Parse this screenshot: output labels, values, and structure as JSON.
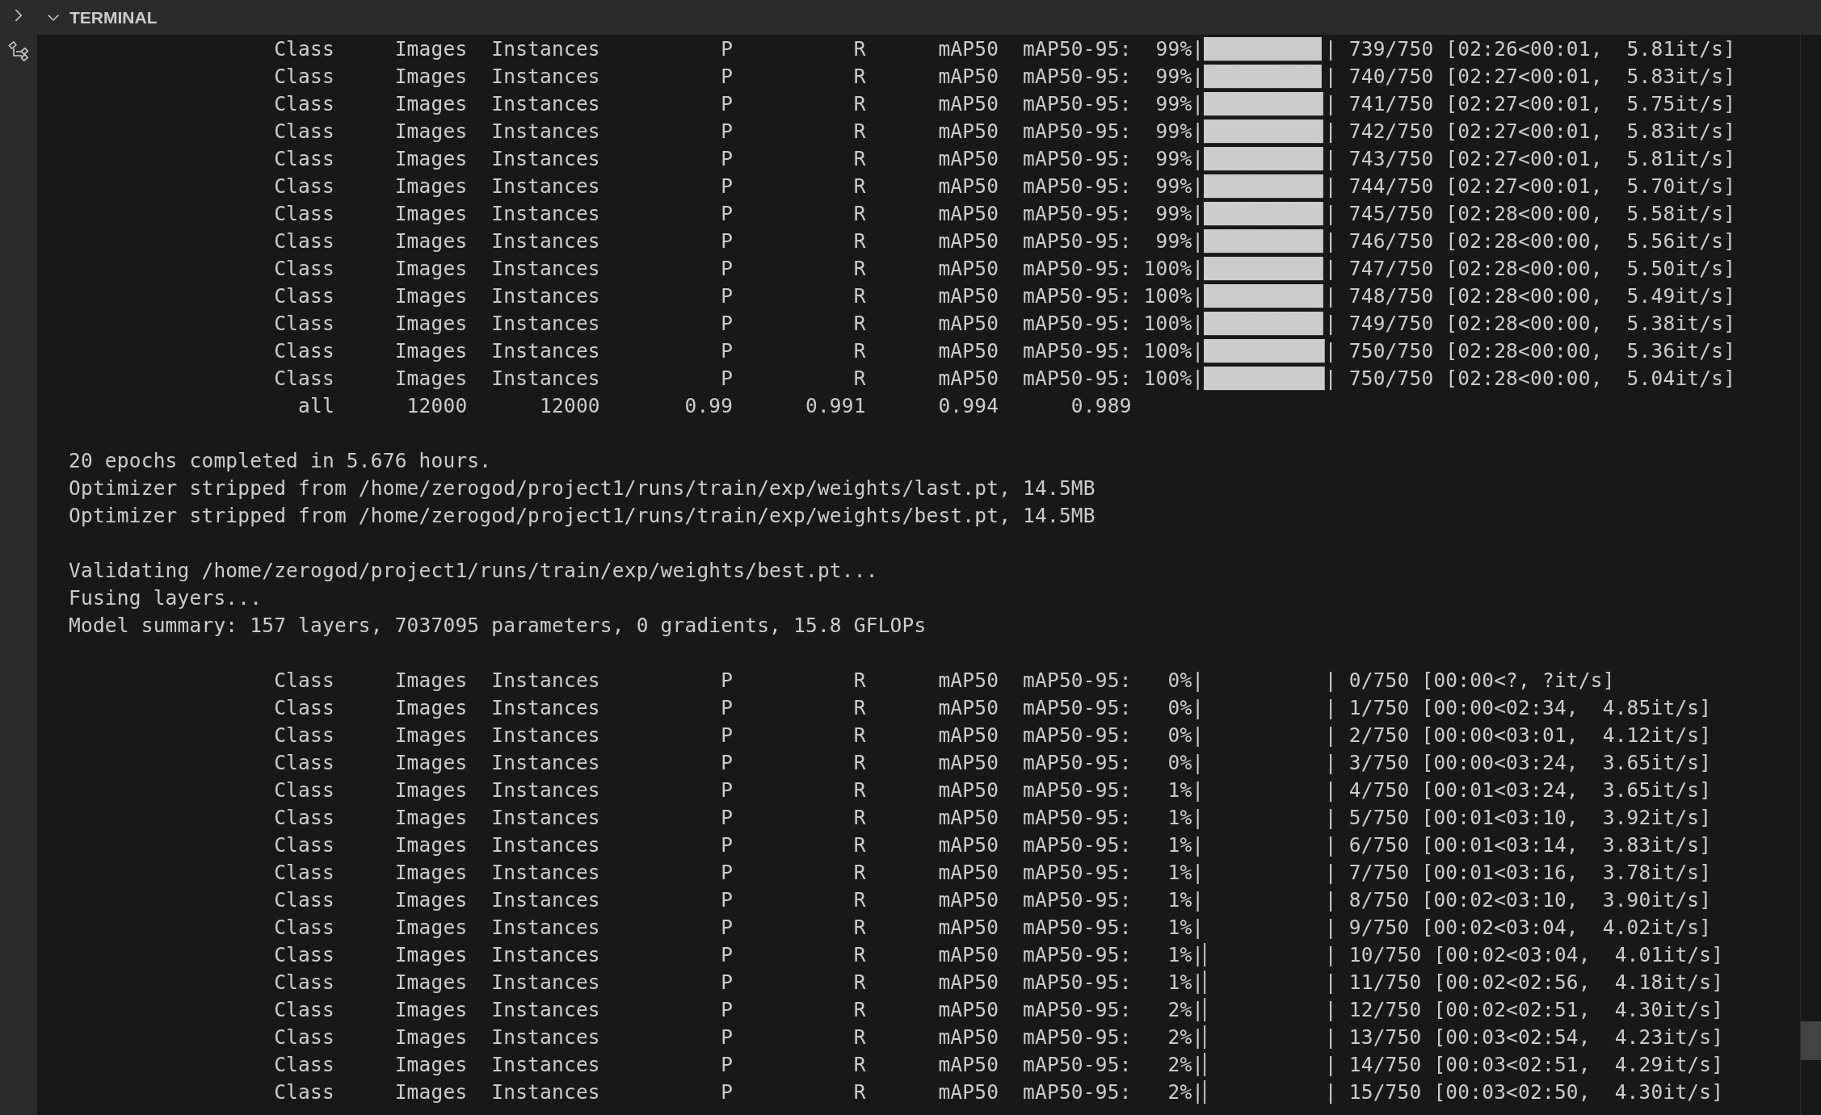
{
  "panel": {
    "title": "TERMINAL",
    "expanded": true
  },
  "terminal": {
    "lines": [
      {
        "kind": "text",
        "text": "                 Class     Images  Instances          P          R      mAP50  mAP50-95:  99%|█████████▊| 739/750 [02:26<00:01,  5.81it/s]"
      },
      {
        "kind": "text",
        "text": "                 Class     Images  Instances          P          R      mAP50  mAP50-95:  99%|█████████▊| 740/750 [02:27<00:01,  5.83it/s]"
      },
      {
        "kind": "text",
        "text": "                 Class     Images  Instances          P          R      mAP50  mAP50-95:  99%|█████████▉| 741/750 [02:27<00:01,  5.75it/s]"
      },
      {
        "kind": "text",
        "text": "                 Class     Images  Instances          P          R      mAP50  mAP50-95:  99%|█████████▉| 742/750 [02:27<00:01,  5.83it/s]"
      },
      {
        "kind": "text",
        "text": "                 Class     Images  Instances          P          R      mAP50  mAP50-95:  99%|█████████▉| 743/750 [02:27<00:01,  5.81it/s]"
      },
      {
        "kind": "text",
        "text": "                 Class     Images  Instances          P          R      mAP50  mAP50-95:  99%|█████████▉| 744/750 [02:27<00:01,  5.70it/s]"
      },
      {
        "kind": "text",
        "text": "                 Class     Images  Instances          P          R      mAP50  mAP50-95:  99%|█████████▉| 745/750 [02:28<00:00,  5.58it/s]"
      },
      {
        "kind": "text",
        "text": "                 Class     Images  Instances          P          R      mAP50  mAP50-95:  99%|█████████▉| 746/750 [02:28<00:00,  5.56it/s]"
      },
      {
        "kind": "text",
        "text": "                 Class     Images  Instances          P          R      mAP50  mAP50-95: 100%|█████████▉| 747/750 [02:28<00:00,  5.50it/s]"
      },
      {
        "kind": "text",
        "text": "                 Class     Images  Instances          P          R      mAP50  mAP50-95: 100%|█████████▉| 748/750 [02:28<00:00,  5.49it/s]"
      },
      {
        "kind": "text",
        "text": "                 Class     Images  Instances          P          R      mAP50  mAP50-95: 100%|█████████▉| 749/750 [02:28<00:00,  5.38it/s]"
      },
      {
        "kind": "text",
        "text": "                 Class     Images  Instances          P          R      mAP50  mAP50-95: 100%|██████████| 750/750 [02:28<00:00,  5.36it/s]"
      },
      {
        "kind": "text",
        "text": "                 Class     Images  Instances          P          R      mAP50  mAP50-95: 100%|██████████| 750/750 [02:28<00:00,  5.04it/s]"
      },
      {
        "kind": "text",
        "text": "                   all      12000      12000       0.99      0.991      0.994      0.989"
      },
      {
        "kind": "blank"
      },
      {
        "kind": "text",
        "text": "20 epochs completed in 5.676 hours."
      },
      {
        "kind": "text",
        "text": "Optimizer stripped from /home/zerogod/project1/runs/train/exp/weights/last.pt, 14.5MB"
      },
      {
        "kind": "text",
        "text": "Optimizer stripped from /home/zerogod/project1/runs/train/exp/weights/best.pt, 14.5MB"
      },
      {
        "kind": "blank"
      },
      {
        "kind": "text",
        "text": "Validating /home/zerogod/project1/runs/train/exp/weights/best.pt..."
      },
      {
        "kind": "text",
        "text": "Fusing layers..."
      },
      {
        "kind": "text",
        "text": "Model summary: 157 layers, 7037095 parameters, 0 gradients, 15.8 GFLOPs"
      },
      {
        "kind": "blank"
      },
      {
        "kind": "text",
        "text": "                 Class     Images  Instances          P          R      mAP50  mAP50-95:   0%|          | 0/750 [00:00<?, ?it/s]"
      },
      {
        "kind": "text",
        "text": "                 Class     Images  Instances          P          R      mAP50  mAP50-95:   0%|          | 1/750 [00:00<02:34,  4.85it/s]"
      },
      {
        "kind": "text",
        "text": "                 Class     Images  Instances          P          R      mAP50  mAP50-95:   0%|          | 2/750 [00:00<03:01,  4.12it/s]"
      },
      {
        "kind": "text",
        "text": "                 Class     Images  Instances          P          R      mAP50  mAP50-95:   0%|          | 3/750 [00:00<03:24,  3.65it/s]"
      },
      {
        "kind": "text",
        "text": "                 Class     Images  Instances          P          R      mAP50  mAP50-95:   1%|          | 4/750 [00:01<03:24,  3.65it/s]"
      },
      {
        "kind": "text",
        "text": "                 Class     Images  Instances          P          R      mAP50  mAP50-95:   1%|          | 5/750 [00:01<03:10,  3.92it/s]"
      },
      {
        "kind": "text",
        "text": "                 Class     Images  Instances          P          R      mAP50  mAP50-95:   1%|          | 6/750 [00:01<03:14,  3.83it/s]"
      },
      {
        "kind": "text",
        "text": "                 Class     Images  Instances          P          R      mAP50  mAP50-95:   1%|          | 7/750 [00:01<03:16,  3.78it/s]"
      },
      {
        "kind": "text",
        "text": "                 Class     Images  Instances          P          R      mAP50  mAP50-95:   1%|          | 8/750 [00:02<03:10,  3.90it/s]"
      },
      {
        "kind": "text",
        "text": "                 Class     Images  Instances          P          R      mAP50  mAP50-95:   1%|          | 9/750 [00:02<03:04,  4.02it/s]"
      },
      {
        "kind": "text",
        "text": "                 Class     Images  Instances          P          R      mAP50  mAP50-95:   1%|▏         | 10/750 [00:02<03:04,  4.01it/s]"
      },
      {
        "kind": "text",
        "text": "                 Class     Images  Instances          P          R      mAP50  mAP50-95:   1%|▏         | 11/750 [00:02<02:56,  4.18it/s]"
      },
      {
        "kind": "text",
        "text": "                 Class     Images  Instances          P          R      mAP50  mAP50-95:   2%|▏         | 12/750 [00:02<02:51,  4.30it/s]"
      },
      {
        "kind": "text",
        "text": "                 Class     Images  Instances          P          R      mAP50  mAP50-95:   2%|▏         | 13/750 [00:03<02:54,  4.23it/s]"
      },
      {
        "kind": "text",
        "text": "                 Class     Images  Instances          P          R      mAP50  mAP50-95:   2%|▏         | 14/750 [00:03<02:51,  4.29it/s]"
      },
      {
        "kind": "text",
        "text": "                 Class     Images  Instances          P          R      mAP50  mAP50-95:   2%|▏         | 15/750 [00:03<02:50,  4.30it/s]"
      }
    ]
  }
}
